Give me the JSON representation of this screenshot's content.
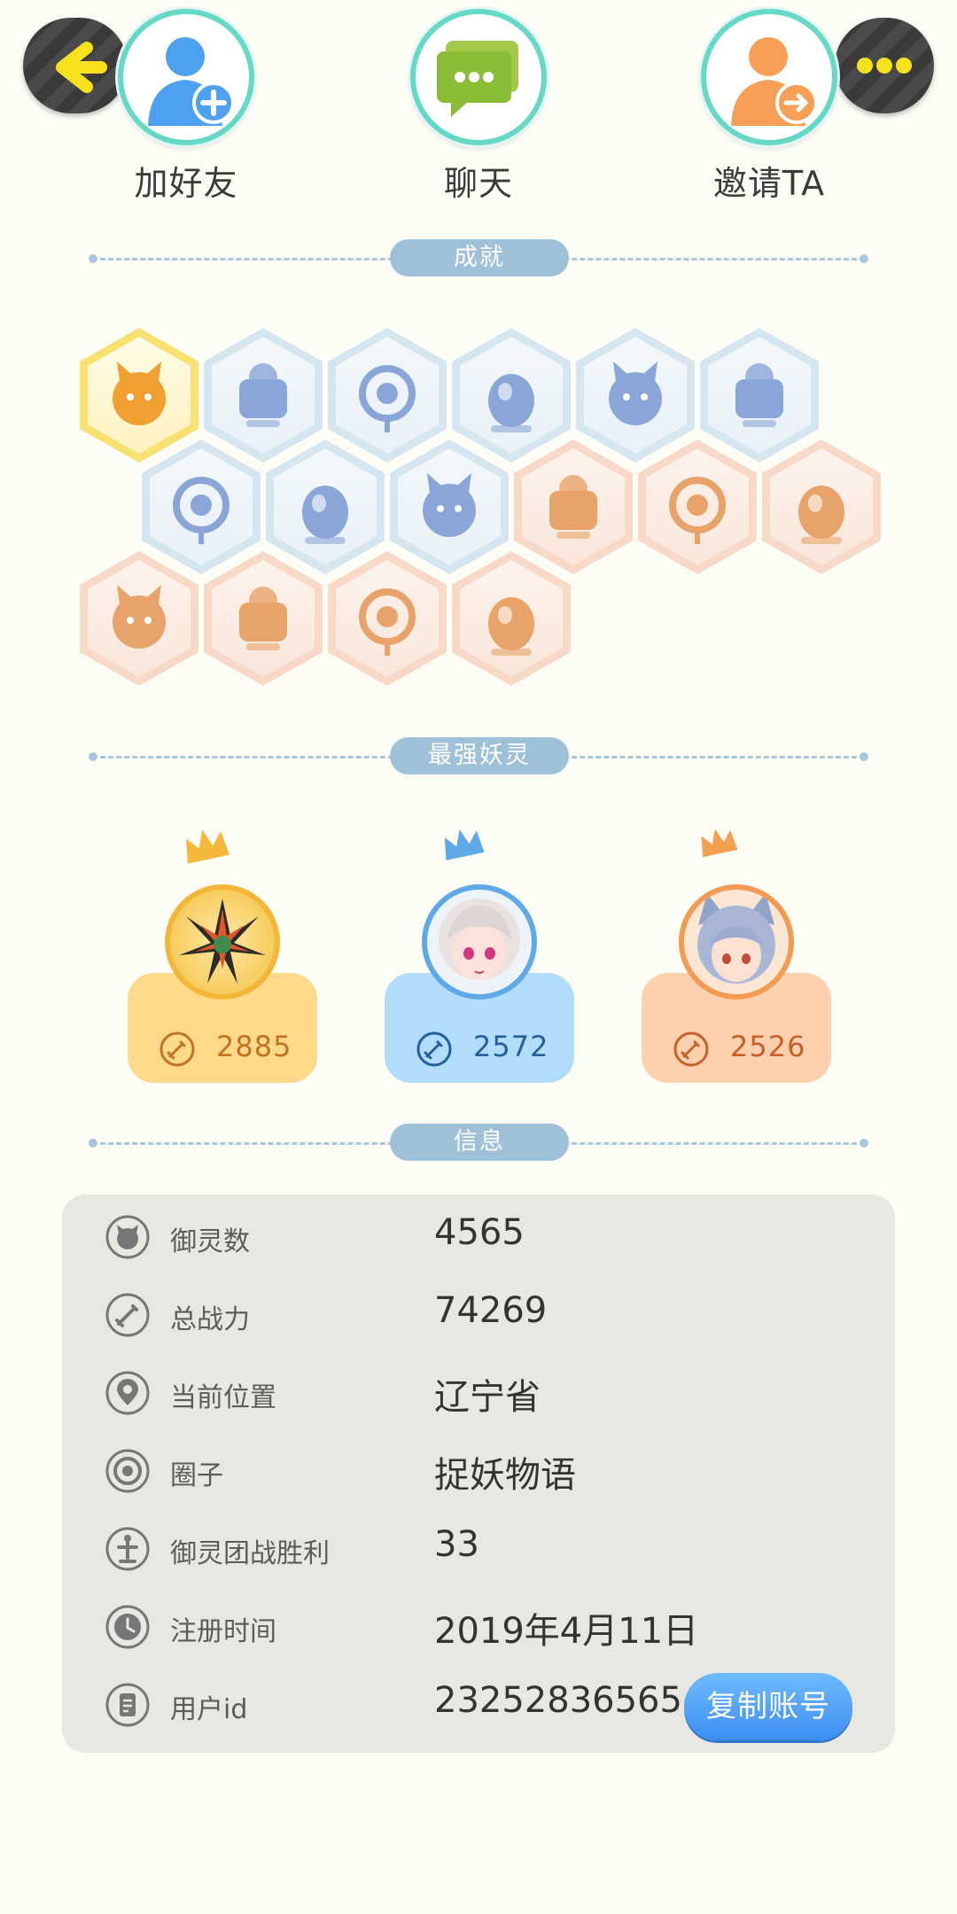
{
  "header": {
    "back_icon": "arrow-left-icon",
    "more_icon": "more-dots-icon"
  },
  "actions": [
    {
      "label": "加好友",
      "icon": "add-friend-icon"
    },
    {
      "label": "聊天",
      "icon": "chat-icon"
    },
    {
      "label": "邀请TA",
      "icon": "invite-icon"
    }
  ],
  "sections": {
    "achievements": "成就",
    "strongest": "最强妖灵",
    "info": "信息"
  },
  "achievements": [
    {
      "icon": "cat-face-badge-icon",
      "style": "gold"
    },
    {
      "icon": "sneaker-badge-icon",
      "style": "blue"
    },
    {
      "icon": "portal-mirror-badge-icon",
      "style": "blue"
    },
    {
      "icon": "crystal-ball-badge-icon",
      "style": "blue"
    },
    {
      "icon": "crystal-egg-badge-icon",
      "style": "blue"
    },
    {
      "icon": "yin-yang-orb-badge-icon",
      "style": "blue"
    },
    {
      "icon": "stroller-badge-icon",
      "style": "blue"
    },
    {
      "icon": "yin-yang-scroll-badge-icon",
      "style": "blue"
    },
    {
      "icon": "book-fox-badge-icon",
      "style": "blue"
    },
    {
      "icon": "moon-sun-badge-icon",
      "style": "orange"
    },
    {
      "icon": "gingerbread-badge-icon",
      "style": "orange"
    },
    {
      "icon": "lollipop-bear-badge-icon",
      "style": "orange"
    },
    {
      "icon": "koi-fish-badge-icon",
      "style": "orange"
    },
    {
      "icon": "shield-badge-icon",
      "style": "orange"
    },
    {
      "icon": "monster-badge-icon",
      "style": "orange"
    },
    {
      "icon": "pawn-badge-icon",
      "style": "orange"
    }
  ],
  "top_spirits": [
    {
      "rank": 1,
      "power": "2885",
      "avatar": "spiky-rainbow-spirit-avatar",
      "color": "#f4b637"
    },
    {
      "rank": 2,
      "power": "2572",
      "avatar": "white-hair-girl-avatar",
      "color": "#5ea9e6"
    },
    {
      "rank": 3,
      "power": "2526",
      "avatar": "fox-ear-girl-avatar",
      "color": "#f39a53"
    }
  ],
  "info": {
    "rows": [
      {
        "label": "御灵数",
        "value": "4565",
        "icon": "spirit-count-icon"
      },
      {
        "label": "总战力",
        "value": "74269",
        "icon": "sword-icon"
      },
      {
        "label": "当前位置",
        "value": "辽宁省",
        "icon": "location-pin-icon"
      },
      {
        "label": "圈子",
        "value": "捉妖物语",
        "icon": "circle-target-icon"
      },
      {
        "label": "御灵团战胜利",
        "value": "33",
        "icon": "trophy-statue-icon"
      },
      {
        "label": "注册时间",
        "value": "2019年4月11日",
        "icon": "clock-icon"
      },
      {
        "label": "用户id",
        "value": "23252836565",
        "icon": "id-card-icon"
      }
    ],
    "copy_button": "复制账号"
  }
}
